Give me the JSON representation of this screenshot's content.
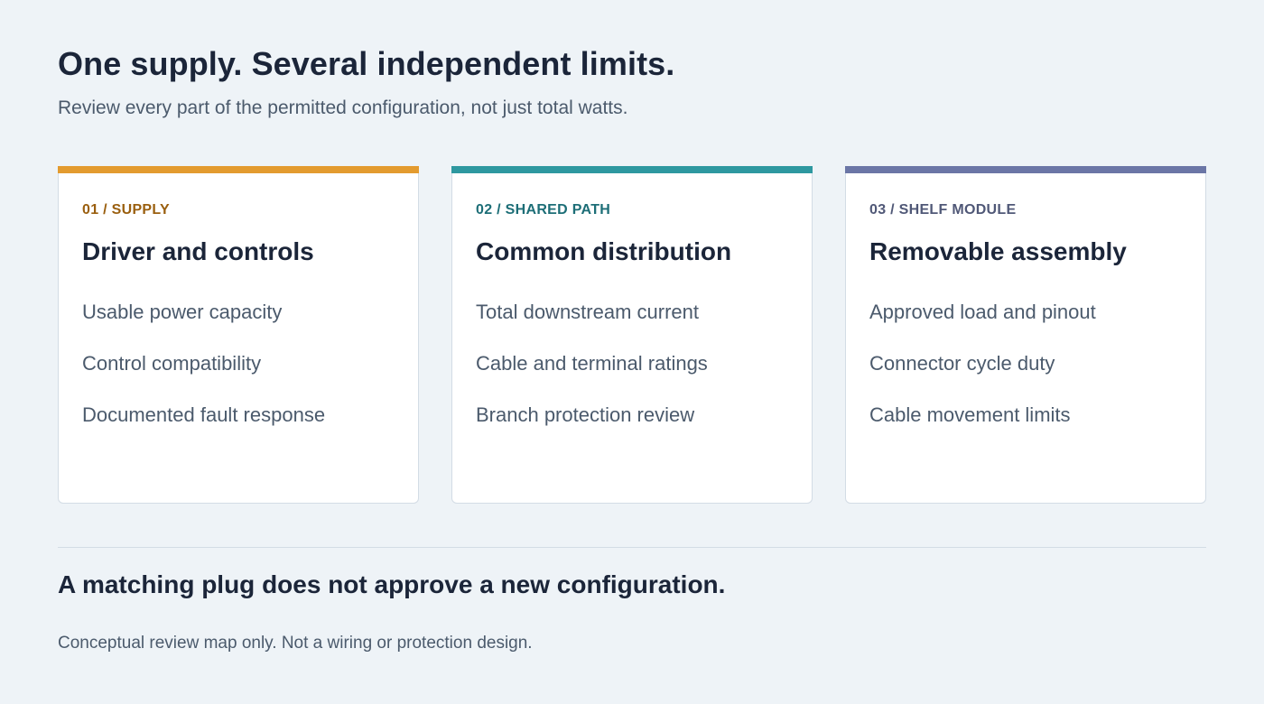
{
  "header": {
    "title": "One supply. Several independent limits.",
    "subtitle": "Review every part of the permitted configuration, not just total watts."
  },
  "cards": [
    {
      "eyebrow": "01 / SUPPLY",
      "title": "Driver and controls",
      "accent_color": "#e39b2f",
      "eyebrow_color": "#9a5f0f",
      "items": [
        "Usable power capacity",
        "Control compatibility",
        "Documented fault response"
      ]
    },
    {
      "eyebrow": "02 / SHARED PATH",
      "title": "Common distribution",
      "accent_color": "#2e98a0",
      "eyebrow_color": "#1d6e77",
      "items": [
        "Total downstream current",
        "Cable and terminal ratings",
        "Branch protection review"
      ]
    },
    {
      "eyebrow": "03 / SHELF MODULE",
      "title": "Removable assembly",
      "accent_color": "#6b76a6",
      "eyebrow_color": "#505877",
      "items": [
        "Approved load and pinout",
        "Connector cycle duty",
        "Cable movement limits"
      ]
    }
  ],
  "statement": "A matching plug does not approve a new configuration.",
  "footnote": "Conceptual review map only. Not a wiring or protection design."
}
